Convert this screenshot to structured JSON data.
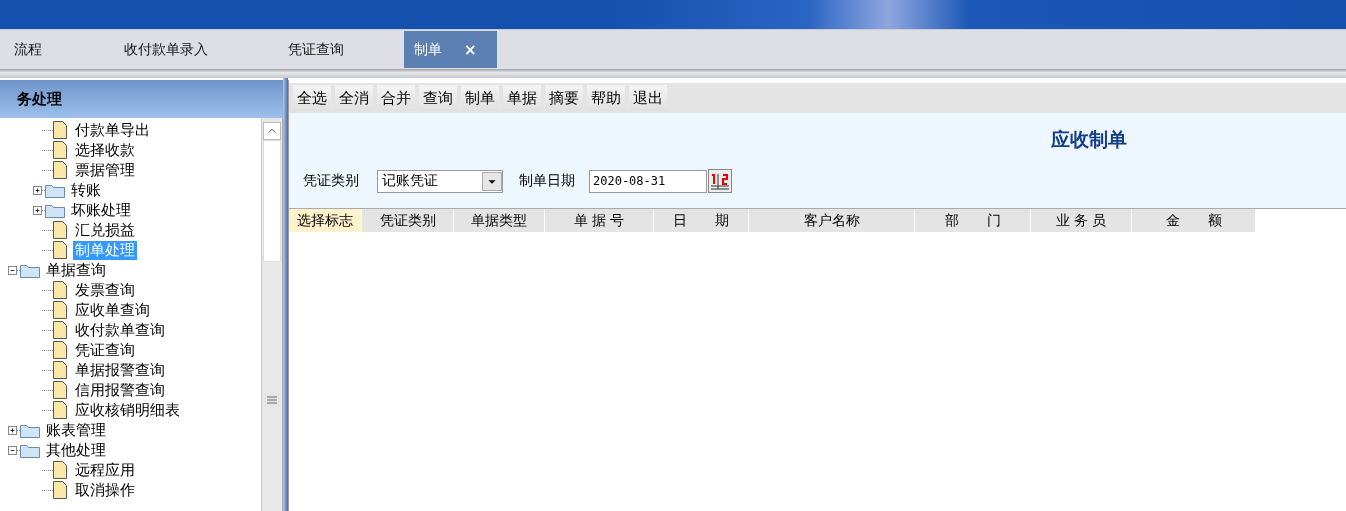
{
  "tabs": [
    {
      "label": "流程",
      "selected": false
    },
    {
      "label": "收付款单录入",
      "selected": false
    },
    {
      "label": "凭证查询",
      "selected": false
    },
    {
      "label": "制单",
      "selected": true,
      "close_glyph": "×"
    }
  ],
  "sidebar": {
    "title": "务处理",
    "tree_continued": [
      {
        "label": "付款单导出",
        "kind": "file",
        "selected": false
      },
      {
        "label": "选择收款",
        "kind": "file",
        "selected": false
      },
      {
        "label": "票据管理",
        "kind": "file",
        "selected": false
      },
      {
        "label": "转账",
        "kind": "folder",
        "expanded": false,
        "selected": false
      },
      {
        "label": "坏账处理",
        "kind": "folder",
        "expanded": false,
        "selected": false
      },
      {
        "label": "汇兑损益",
        "kind": "file",
        "selected": false
      },
      {
        "label": "制单处理",
        "kind": "file",
        "selected": true
      }
    ],
    "tree": [
      {
        "label": "单据查询",
        "kind": "folder",
        "expanded": true,
        "selected": false,
        "children": [
          {
            "label": "发票查询",
            "kind": "file",
            "selected": false
          },
          {
            "label": "应收单查询",
            "kind": "file",
            "selected": false
          },
          {
            "label": "收付款单查询",
            "kind": "file",
            "selected": false
          },
          {
            "label": "凭证查询",
            "kind": "file",
            "selected": false
          },
          {
            "label": "单据报警查询",
            "kind": "file",
            "selected": false
          },
          {
            "label": "信用报警查询",
            "kind": "file",
            "selected": false
          },
          {
            "label": "应收核销明细表",
            "kind": "file",
            "selected": false
          }
        ]
      },
      {
        "label": "账表管理",
        "kind": "folder",
        "expanded": false,
        "selected": false
      },
      {
        "label": "其他处理",
        "kind": "folder",
        "expanded": true,
        "selected": false,
        "children": [
          {
            "label": "远程应用",
            "kind": "file",
            "selected": false
          },
          {
            "label": "取消操作",
            "kind": "file",
            "selected": false
          }
        ]
      }
    ]
  },
  "toolbar": [
    "全选",
    "全消",
    "合并",
    "查询",
    "制单",
    "单据",
    "摘要",
    "帮助",
    "退出"
  ],
  "form": {
    "title": "应收制单",
    "voucher_type_label": "凭证类别",
    "voucher_type": "记账凭证",
    "date_label": "制单日期",
    "date": "2020-08-31"
  },
  "table": {
    "columns": [
      {
        "label": "选择标志",
        "selected": true
      },
      {
        "label": "凭证类别",
        "selected": false
      },
      {
        "label": "单据类型",
        "selected": false
      },
      {
        "label": "单 据 号",
        "selected": false
      },
      {
        "label": "日　　期",
        "selected": false
      },
      {
        "label": "客户名称",
        "selected": false
      },
      {
        "label": "部　　门",
        "selected": false
      },
      {
        "label": "业 务 员",
        "selected": false
      },
      {
        "label": "金　　额",
        "selected": false
      }
    ]
  }
}
